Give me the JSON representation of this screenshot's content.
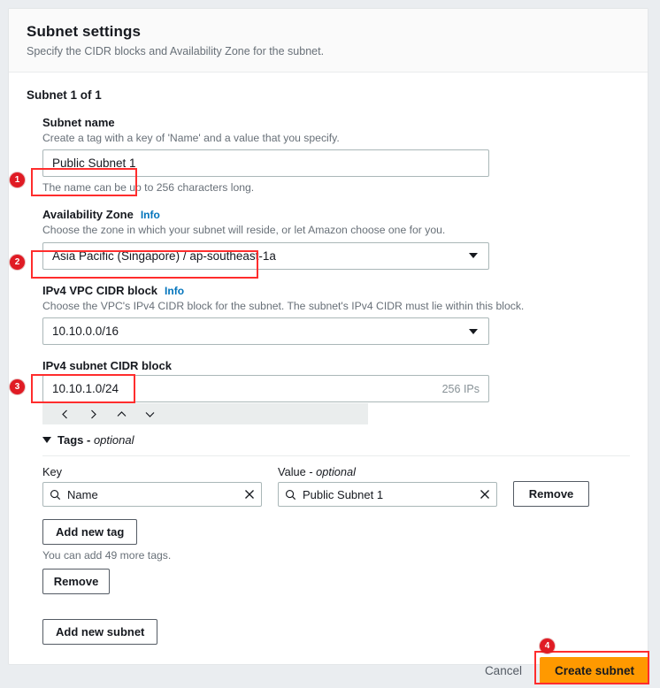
{
  "panel": {
    "title": "Subnet settings",
    "subtitle": "Specify the CIDR blocks and Availability Zone for the subnet.",
    "section_title": "Subnet 1 of 1"
  },
  "fields": {
    "subnet_name": {
      "label": "Subnet name",
      "description": "Create a tag with a key of 'Name' and a value that you specify.",
      "value": "Public Subnet 1",
      "placeholder": "",
      "hint": "The name can be up to 256 characters long."
    },
    "availability_zone": {
      "label": "Availability Zone",
      "info": "Info",
      "description": "Choose the zone in which your subnet will reside, or let Amazon choose one for you.",
      "value": "Asia Pacific (Singapore) / ap-southeast-1a"
    },
    "vpc_cidr": {
      "label": "IPv4 VPC CIDR block",
      "info": "Info",
      "description": "Choose the VPC's IPv4 CIDR block for the subnet. The subnet's IPv4 CIDR must lie within this block.",
      "value": "10.10.0.0/16"
    },
    "subnet_cidr": {
      "label": "IPv4 subnet CIDR block",
      "value": "10.10.1.0/24",
      "suffix": "256 IPs",
      "stepper": [
        {
          "name": "prev",
          "glyph": "‹"
        },
        {
          "name": "next",
          "glyph": "›"
        },
        {
          "name": "up",
          "glyph": "⌃"
        },
        {
          "name": "down",
          "glyph": "⌄"
        }
      ]
    }
  },
  "tags": {
    "toggle_label": "Tags - ",
    "toggle_optional": "optional",
    "key_header": "Key",
    "value_header": "Value - ",
    "value_optional": "optional",
    "rows": [
      {
        "key": "Name",
        "value": "Public Subnet 1",
        "remove_label": "Remove"
      }
    ],
    "add_tag_label": "Add new tag",
    "remaining_hint": "You can add 49 more tags."
  },
  "actions": {
    "remove_subnet_label": "Remove",
    "add_subnet_label": "Add new subnet",
    "cancel_label": "Cancel",
    "create_label": "Create subnet"
  },
  "annotations": {
    "badges": [
      {
        "id": "1",
        "number": "1"
      },
      {
        "id": "2",
        "number": "2"
      },
      {
        "id": "3",
        "number": "3"
      },
      {
        "id": "4",
        "number": "4"
      }
    ],
    "highlight_color": "#ff2d2d",
    "badge_color": "#e01b24"
  },
  "theme": {
    "primary_button_color": "#ff9900",
    "link_color": "#0073bb",
    "page_background": "#eaedf0"
  }
}
